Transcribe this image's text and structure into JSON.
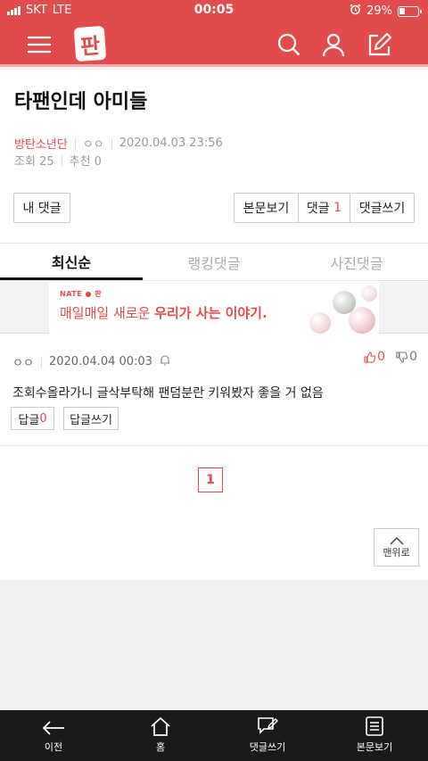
{
  "status": {
    "carrier": "SKT",
    "network": "LTE",
    "time": "00:05",
    "battery_percent": "29%",
    "battery_level": 0.29
  },
  "header": {
    "logo": "판",
    "icons": [
      "menu-icon",
      "search-icon",
      "user-icon",
      "write-icon"
    ]
  },
  "post": {
    "title": "타팬인데 아미들",
    "board": "방탄소년단",
    "author": "ㅇㅇ",
    "datetime": "2020.04.03 23:56",
    "views_label": "조회",
    "views": "25",
    "recommend_label": "추천",
    "recommend": "0"
  },
  "actions": {
    "my_comments": "내 댓글",
    "view_post": "본문보기",
    "comments_label": "댓글",
    "comments_count": "1",
    "write_comment": "댓글쓰기"
  },
  "tabs": [
    {
      "label": "최신순",
      "active": true
    },
    {
      "label": "랭킹댓글",
      "active": false
    },
    {
      "label": "사진댓글",
      "active": false
    }
  ],
  "ad": {
    "brand": "NATE ● 판",
    "text_plain": "매일매일 새로운 ",
    "text_bold": "우리가 사는 이야기."
  },
  "comments": [
    {
      "author": "ㅇㅇ",
      "datetime": "2020.04.04 00:03",
      "likes": "0",
      "dislikes": "0",
      "text": "조회수올라가니 글삭부탁해 팬덤분란 키워봤자 좋을 거 없음",
      "reply_label": "답글",
      "reply_count": "0",
      "write_reply": "답글쓰기"
    }
  ],
  "pagination": {
    "current": "1"
  },
  "to_top": "맨위로",
  "bottom_nav": [
    {
      "label": "이전",
      "icon": "back-arrow-icon"
    },
    {
      "label": "홈",
      "icon": "home-icon"
    },
    {
      "label": "댓글쓰기",
      "icon": "comment-write-icon"
    },
    {
      "label": "본문보기",
      "icon": "document-icon"
    }
  ],
  "colors": {
    "accent": "#e24b4b",
    "bottom_bar": "#1a1a1a"
  }
}
